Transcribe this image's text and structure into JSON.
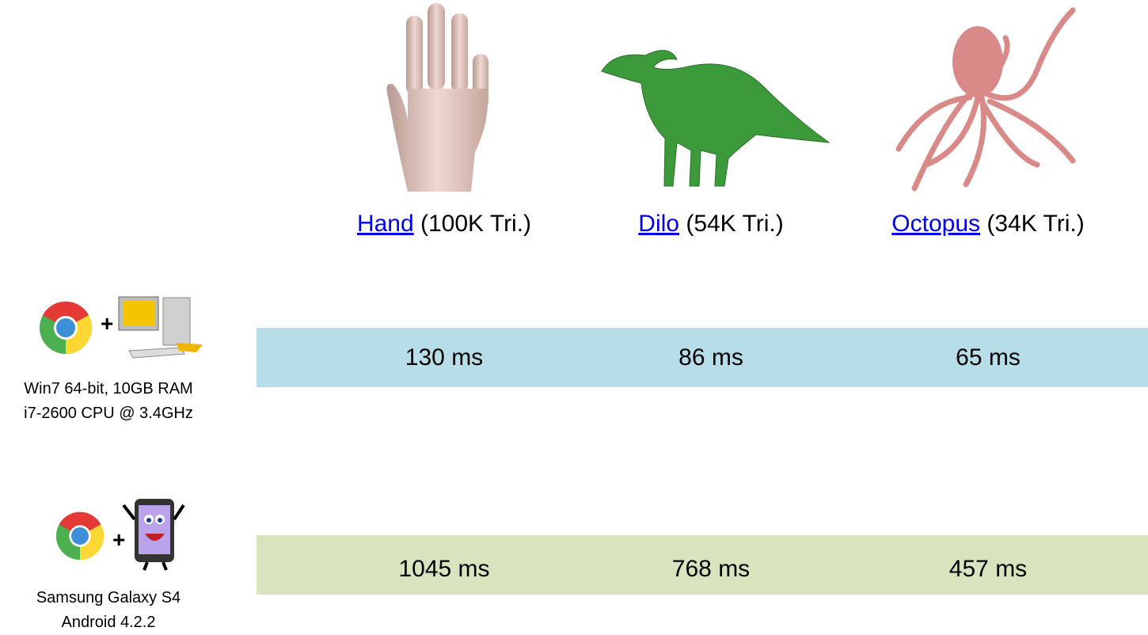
{
  "models": [
    {
      "name": "Hand",
      "detail": " (100K Tri.)",
      "color": "#e2c3bd"
    },
    {
      "name": "Dilo",
      "detail": " (54K Tri.)",
      "color": "#3d9a3a"
    },
    {
      "name": "Octopus",
      "detail": " (34K Tri.)",
      "color": "#d98a88"
    }
  ],
  "devices": [
    {
      "icons": [
        "chrome-icon",
        "desktop-computer-icon"
      ],
      "plus": "+",
      "label_line1": "Win7 64-bit, 10GB RAM",
      "label_line2": "i7-2600 CPU @ 3.4GHz",
      "bar_color": "#b7dde8",
      "times": [
        "130 ms",
        "86 ms",
        "65 ms"
      ]
    },
    {
      "icons": [
        "chrome-icon",
        "cartoon-phone-icon"
      ],
      "plus": "+",
      "label_line1": "Samsung Galaxy S4",
      "label_line2": "Android 4.2.2",
      "bar_color": "#d7e4bd",
      "times": [
        "1045 ms",
        "768 ms",
        "457 ms"
      ]
    }
  ]
}
